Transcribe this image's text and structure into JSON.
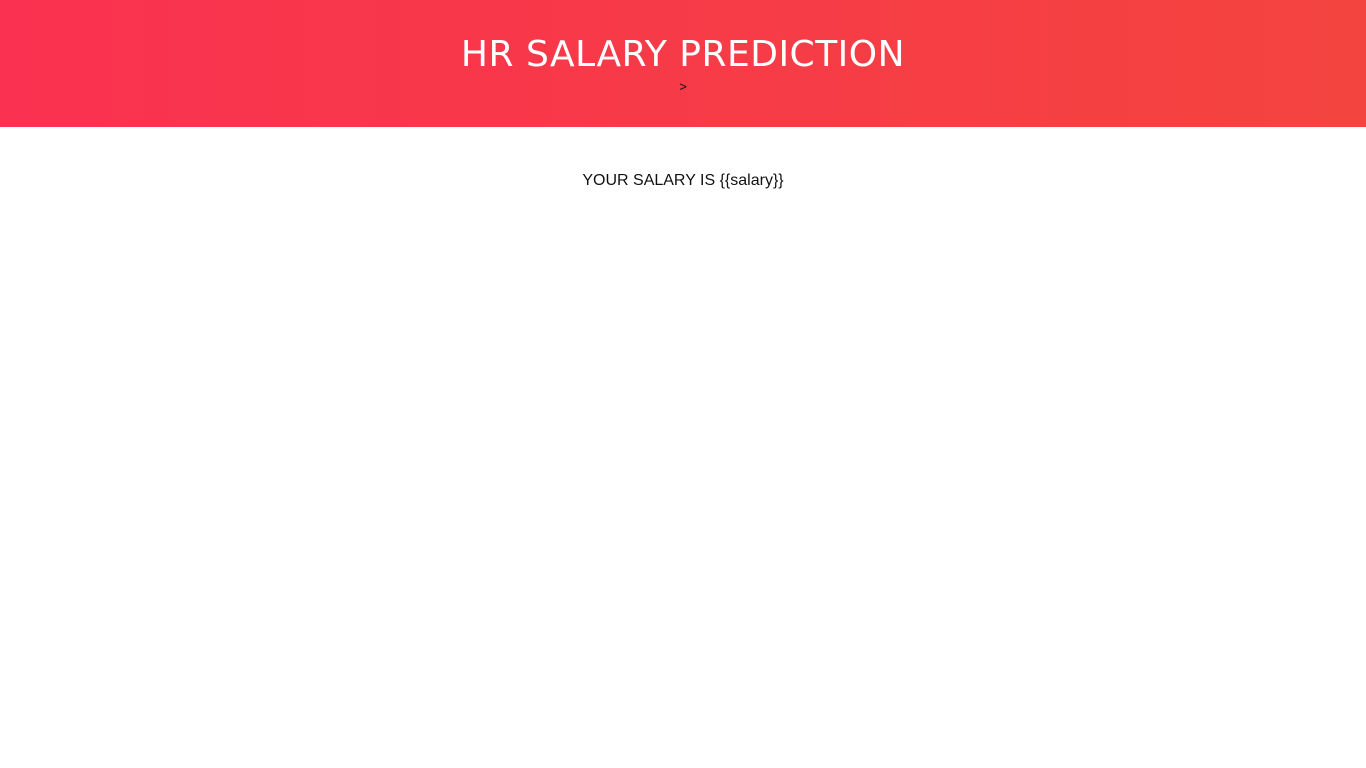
{
  "header": {
    "title": "HR SALARY PREDICTION",
    "subtext": ">"
  },
  "main": {
    "result_text": "YOUR SALARY IS {{salary}}"
  },
  "colors": {
    "header_gradient_start": "#fa3150",
    "header_gradient_end": "#f4443f",
    "title_text": "#ffffff",
    "body_text": "#111111",
    "background": "#ffffff"
  }
}
